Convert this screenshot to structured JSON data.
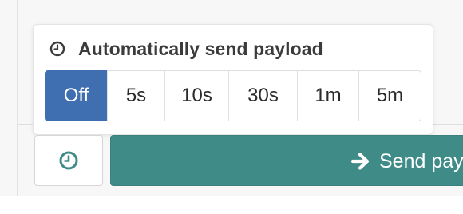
{
  "popover": {
    "title": "Automatically send payload",
    "header_icon": "clock-icon",
    "intervals": [
      {
        "label": "Off",
        "selected": true
      },
      {
        "label": "5s",
        "selected": false
      },
      {
        "label": "10s",
        "selected": false
      },
      {
        "label": "30s",
        "selected": false
      },
      {
        "label": "1m",
        "selected": false
      },
      {
        "label": "5m",
        "selected": false
      }
    ]
  },
  "actions": {
    "timer_icon": "clock-icon",
    "send_icon": "arrow-right-icon",
    "send_label": "Send pay"
  },
  "colors": {
    "selected_option": "#3f6fb0",
    "send_button": "#3f8b87",
    "timer_icon": "#3f8b87",
    "title_text": "#3b3b3b"
  }
}
